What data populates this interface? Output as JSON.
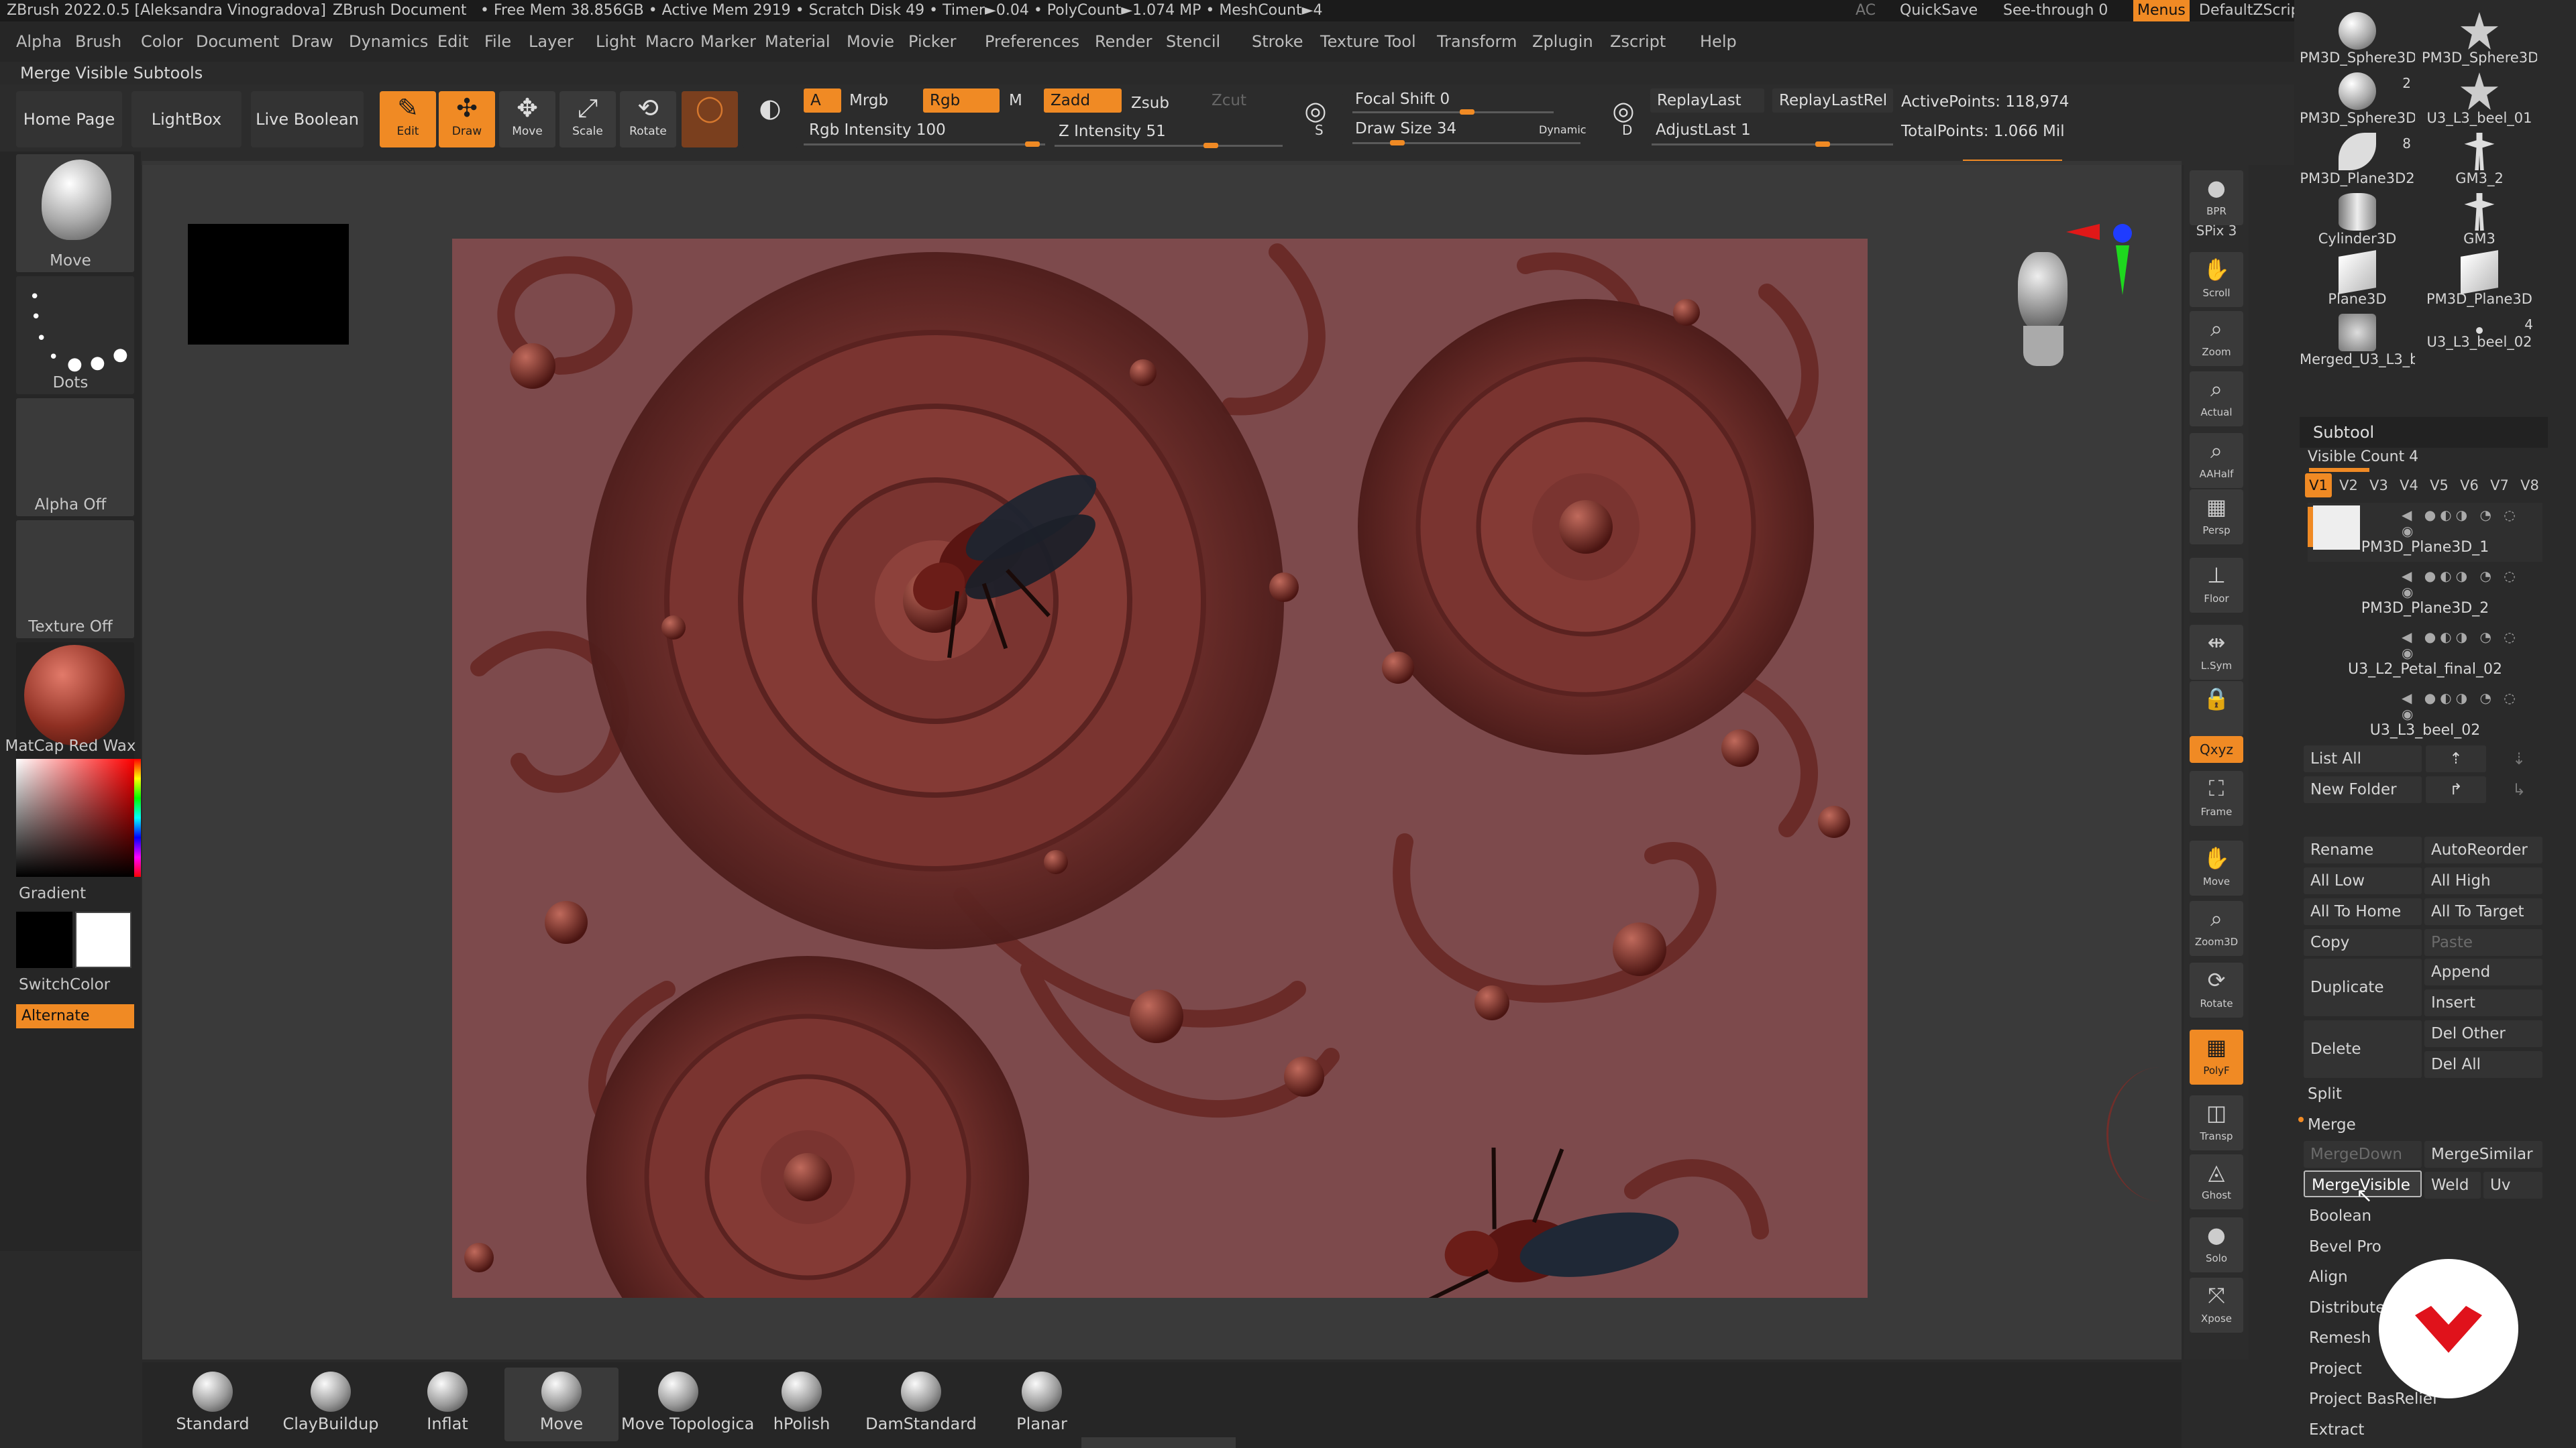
{
  "titlebar": {
    "app": "ZBrush 2022.0.5 [Aleksandra Vinogradova]",
    "document": "ZBrush Document",
    "stats": "• Free Mem 38.856GB • Active Mem 2919 • Scratch Disk 49 • Timer►0.04 • PolyCount►1.074 MP • MeshCount►4",
    "ac": "AC",
    "quicksave": "QuickSave",
    "see_through": "See-through  0",
    "menus": "Menus",
    "zscript": "DefaultZScript"
  },
  "menubar": [
    "Alpha",
    "Brush",
    "Color",
    "Document",
    "Draw",
    "Dynamics",
    "Edit",
    "File",
    "Layer",
    "Light",
    "Macro",
    "Marker",
    "Material",
    "Movie",
    "Picker",
    "Preferences",
    "Render",
    "Stencil",
    "Stroke",
    "Texture",
    "Tool",
    "Transform",
    "Zplugin",
    "Zscript",
    "Help"
  ],
  "hint": "Merge Visible Subtools",
  "toolbar": {
    "home": "Home Page",
    "lightbox": "LightBox",
    "live_boolean": "Live Boolean",
    "tools": [
      "Edit",
      "Draw",
      "Move",
      "Scale",
      "Rotate"
    ],
    "a": "A",
    "mrgb": "Mrgb",
    "rgb": "Rgb",
    "m": "M",
    "zadd": "Zadd",
    "zsub": "Zsub",
    "zcut": "Zcut",
    "rgb_intensity": "Rgb Intensity 100",
    "z_intensity": "Z Intensity 51",
    "focal_shift": "Focal Shift 0",
    "draw_size": "Draw Size 34",
    "dynamic": "Dynamic",
    "replay_last": "ReplayLast",
    "replay_last_rel": "ReplayLastRel",
    "adjust_last": "AdjustLast 1",
    "active_points": "ActivePoints: 118,974",
    "total_points": "TotalPoints: 1.066 Mil",
    "s_label": "S",
    "d_label": "D"
  },
  "leftpanel": {
    "move": "Move",
    "dots": "Dots",
    "alpha": "Alpha Off",
    "texture": "Texture Off",
    "matcap": "MatCap Red Wax",
    "gradient": "Gradient",
    "switch": "SwitchColor",
    "alternate": "Alternate"
  },
  "rightcol": [
    {
      "name": "bpr",
      "label": "BPR"
    },
    {
      "name": "spix",
      "label": "SPix 3"
    },
    {
      "name": "scroll",
      "label": "Scroll"
    },
    {
      "name": "zoom",
      "label": "Zoom"
    },
    {
      "name": "actual",
      "label": "Actual"
    },
    {
      "name": "aahalf",
      "label": "AAHalf"
    },
    {
      "name": "persp",
      "label": "Persp"
    },
    {
      "name": "floor",
      "label": "Floor"
    },
    {
      "name": "lsym",
      "label": "L.Sym"
    },
    {
      "name": "lock",
      "label": ""
    },
    {
      "name": "xyz",
      "label": "Qxyz"
    },
    {
      "name": "frame",
      "label": "Frame"
    },
    {
      "name": "move",
      "label": "Move"
    },
    {
      "name": "zoom3d",
      "label": "Zoom3D"
    },
    {
      "name": "rotate",
      "label": "Rotate"
    },
    {
      "name": "polyf",
      "label": "PolyF"
    },
    {
      "name": "transp",
      "label": "Transp"
    },
    {
      "name": "ghost",
      "label": "Ghost"
    },
    {
      "name": "solo",
      "label": "Solo"
    },
    {
      "name": "xpose",
      "label": "Xpose"
    }
  ],
  "brushes": [
    "Standard",
    "ClayBuildup",
    "Inflat",
    "Move",
    "Move Topologica",
    "hPolish",
    "DamStandard",
    "Planar"
  ],
  "toolgrid": [
    {
      "label": "PM3D_Sphere3D",
      "shape": "sphere",
      "count": ""
    },
    {
      "label": "PM3D_Sphere3D",
      "shape": "star",
      "count": ""
    },
    {
      "label": "PM3D_Sphere3D",
      "shape": "blob",
      "count": "2"
    },
    {
      "label": "U3_L3_beel_01",
      "shape": "star",
      "count": ""
    },
    {
      "label": "PM3D_Plane3D2",
      "shape": "petal",
      "count": "8"
    },
    {
      "label": "GM3_2",
      "shape": "figure",
      "count": ""
    },
    {
      "label": "Cylinder3D",
      "shape": "cylinder",
      "count": ""
    },
    {
      "label": "GM3",
      "shape": "figure",
      "count": ""
    },
    {
      "label": "Plane3D",
      "shape": "plane",
      "count": ""
    },
    {
      "label": "PM3D_Plane3D",
      "shape": "plane",
      "count": ""
    },
    {
      "label": "Merged_U3_L3_b",
      "shape": "merged",
      "count": ""
    },
    {
      "label": "U3_L3_beel_02",
      "shape": "dot",
      "count": "4"
    }
  ],
  "subtool": {
    "title": "Subtool",
    "visible_count": "Visible Count 4",
    "tabs": [
      "V1",
      "V2",
      "V3",
      "V4",
      "V5",
      "V6",
      "V7",
      "V8"
    ],
    "items": [
      "PM3D_Plane3D_1",
      "PM3D_Plane3D_2",
      "U3_L2_Petal_final_02",
      "U3_L3_beel_02"
    ],
    "list_all": "List All",
    "new_folder": "New Folder",
    "rename": "Rename",
    "autoreorder": "AutoReorder",
    "all_low": "All Low",
    "all_high": "All High",
    "all_to_home": "All To Home",
    "all_to_target": "All To Target",
    "copy": "Copy",
    "paste": "Paste",
    "duplicate": "Duplicate",
    "append": "Append",
    "insert": "Insert",
    "delete": "Delete",
    "del_other": "Del Other",
    "del_all": "Del All",
    "split": "Split",
    "merge": "Merge",
    "merge_down": "MergeDown",
    "merge_similar": "MergeSimilar",
    "merge_visible": "MergeVisible",
    "weld": "Weld",
    "uv": "Uv",
    "sections": [
      "Boolean",
      "Bevel Pro",
      "Align",
      "Distribute",
      "Remesh",
      "Project",
      "Project BasRelief",
      "Extract"
    ]
  },
  "colors": {
    "accent": "#f08a24",
    "bg": "#2a2a2a",
    "relief": "#7d4a4c"
  }
}
